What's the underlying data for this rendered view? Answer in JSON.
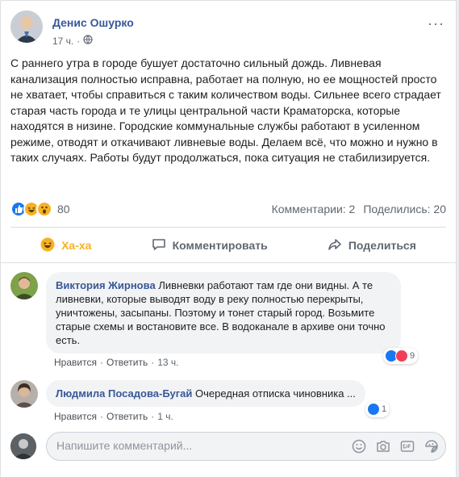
{
  "post": {
    "author": "Денис Ошурко",
    "time": "17 ч.",
    "audience_icon": "globe-icon",
    "text": "С раннего утра в городе бушует достаточно сильный дождь. Ливневая канализация полностью исправна, работает на полную, но ее мощностей просто не хватает, чтобы справиться с таким количеством воды. Сильнее всего страдает старая часть города и те улицы центральной части Краматорска, которые находятся в низине. Городские коммунальные службы работают в усиленном режиме, отводят и откачивают ливневые воды. Делаем всё, что можно и нужно в таких случаях. Работы будут продолжаться, пока ситуация не стабилизируется.",
    "reaction_count": "80",
    "comments_count": "Комментарии: 2",
    "shares_count": "Поделились: 20"
  },
  "actions": {
    "reaction_label": "Ха-ха",
    "comment_label": "Комментировать",
    "share_label": "Поделиться"
  },
  "comments": [
    {
      "author": "Виктория Жирнова",
      "text": "Ливневки работают там где они видны. А те ливневки, которые выводят воду в реку полностью перекрыты, уничтожены, засыпаны. Поэтому и тонет старый город. Возьмите старые схемы и востановите все. В водоканале в архиве они точно есть.",
      "like": "Нравится",
      "reply": "Ответить",
      "time": "13 ч.",
      "reaction_count": "9"
    },
    {
      "author": "Людмила Посадова-Бугай",
      "text": "Очередная отписка чиновника ...",
      "like": "Нравится",
      "reply": "Ответить",
      "time": "1 ч.",
      "reaction_count": "1"
    }
  ],
  "composer": {
    "placeholder": "Напишите комментарий..."
  },
  "colors": {
    "link": "#385898",
    "like_blue": "#1877f2",
    "haha_yellow": "#f7b125",
    "love_red": "#f33e58"
  }
}
